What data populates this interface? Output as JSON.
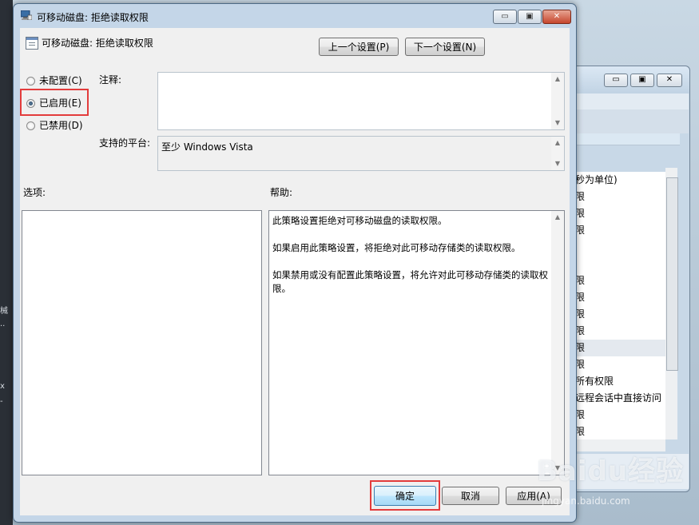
{
  "background_window": {
    "rows": [
      "秒为单位)",
      "限",
      "限",
      "限",
      "",
      "",
      "限",
      "限",
      "限",
      "限",
      "限",
      "限",
      "所有权限",
      "远程会话中直接访问",
      "限",
      "限"
    ],
    "selected_row_index": 10
  },
  "window": {
    "title": "可移动磁盘: 拒绝读取权限",
    "close_label": "✕",
    "min_label": "▭",
    "max_label": "▣"
  },
  "header": {
    "policy_name": "可移动磁盘: 拒绝读取权限",
    "prev_button": "上一个设置(P)",
    "next_button": "下一个设置(N)"
  },
  "state": {
    "options": [
      {
        "label": "未配置(C)",
        "selected": false
      },
      {
        "label": "已启用(E)",
        "selected": true
      },
      {
        "label": "已禁用(D)",
        "selected": false
      }
    ]
  },
  "comment": {
    "label": "注释:",
    "value": ""
  },
  "platform": {
    "label": "支持的平台:",
    "value": "至少 Windows Vista"
  },
  "options_panel": {
    "label": "选项:"
  },
  "help_panel": {
    "label": "帮助:",
    "paragraphs": [
      "此策略设置拒绝对可移动磁盘的读取权限。",
      "如果启用此策略设置，将拒绝对此可移动存储类的读取权限。",
      "如果禁用或没有配置此策略设置，将允许对此可移动存储类的读取权限。"
    ]
  },
  "footer": {
    "ok": "确定",
    "cancel": "取消",
    "apply": "应用(A)"
  },
  "watermark": {
    "brand": "Baidu经验",
    "site": "jingyan.baidu.com"
  },
  "desktop_left_glyphs": [
    "械",
    "..",
    "x",
    "-"
  ]
}
